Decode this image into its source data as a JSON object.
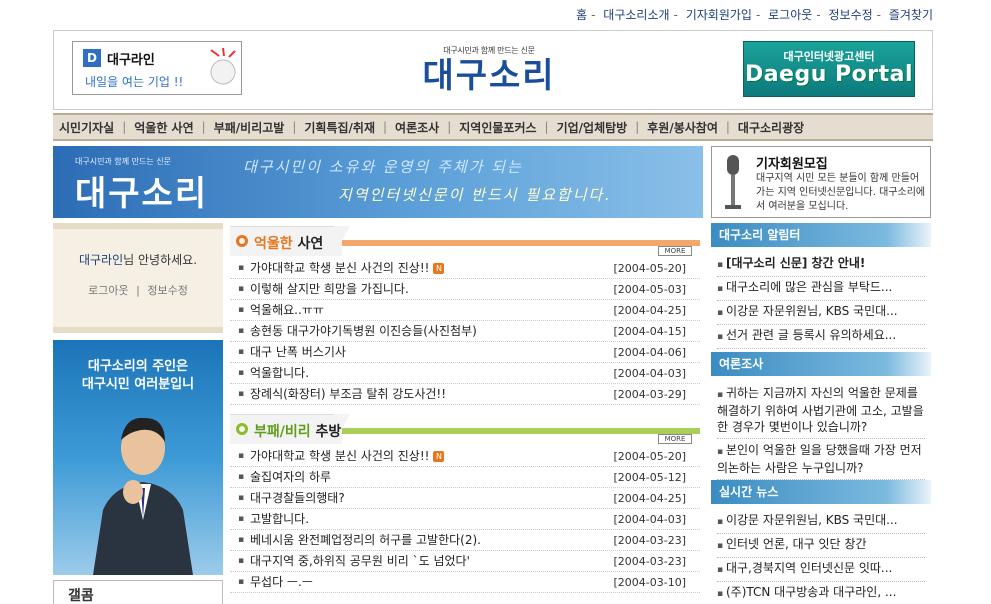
{
  "toplinks": [
    "홈",
    "대구소리소개",
    "기자회원가입",
    "로그아웃",
    "정보수정",
    "즐겨찾기"
  ],
  "header": {
    "daeguline": {
      "icon_letter": "D",
      "title": "대구라인",
      "subtitle": "내일을 여는 기업 !!"
    },
    "logo": {
      "tagline": "대구시민과 함께 만드는 신문",
      "name": "대구소리"
    },
    "portal": {
      "top": "대구인터넷광고센터",
      "main": "Daegu Portal"
    }
  },
  "menu": [
    "시민기자실",
    "억울한 사연",
    "부패/비리고발",
    "기획특집/취재",
    "여론조사",
    "지역인물포커스",
    "기업/업체탐방",
    "후원/봉사참여",
    "대구소리광장"
  ],
  "banner": {
    "tagline": "대구시민과 함께 만드는 신문",
    "logo": "대구소리",
    "line1": "대구시민이 소유와 운영의 주체가 되는",
    "line2": "지역인터넷신문이 반드시 필요합니다."
  },
  "recruit": {
    "title": "기자회원모집",
    "body": "대구지역 시민 모든 분들이 함께 만들어가는 지역 인터넷신문입니다. 대구소리에서 여러분을 모십니다."
  },
  "greeting": {
    "user": "대구라인",
    "suffix": "님 안녕하세요.",
    "logout": "로그아웃",
    "edit": "정보수정",
    "sep": "|"
  },
  "owner_banner": {
    "line1": "대구소리의 주인은",
    "line2": "대구시민 여러분입니"
  },
  "column": {
    "title": "갤콤"
  },
  "sections": [
    {
      "title_hl": "억울한",
      "title_rest": " 사연",
      "more": "MORE",
      "items": [
        {
          "title": "가야대학교 학생 분신 사건의 진상!!",
          "new": true,
          "date": "[2004-05-20]"
        },
        {
          "title": "이렇해 살지만 희망을 가집니다.",
          "new": false,
          "date": "[2004-05-03]"
        },
        {
          "title": "억울해요..ㅠㅠ",
          "new": false,
          "date": "[2004-04-25]"
        },
        {
          "title": "송현동 대구가야기독병원 이진승들(사진첨부)",
          "new": false,
          "date": "[2004-04-15]"
        },
        {
          "title": "대구 난폭 버스기사",
          "new": false,
          "date": "[2004-04-06]"
        },
        {
          "title": "억울합니다.",
          "new": false,
          "date": "[2004-04-03]"
        },
        {
          "title": "장례식(화장터) 부조금 탈취 강도사건!!",
          "new": false,
          "date": "[2004-03-29]"
        }
      ]
    },
    {
      "title_hl": "부패/비리",
      "title_rest": " 추방",
      "more": "MORE",
      "items": [
        {
          "title": "가야대학교 학생 분신 사건의 진상!!",
          "new": true,
          "date": "[2004-05-20]"
        },
        {
          "title": "술집여자의 하루",
          "new": false,
          "date": "[2004-05-12]"
        },
        {
          "title": "대구경찰들의행태?",
          "new": false,
          "date": "[2004-04-25]"
        },
        {
          "title": "고발합니다.",
          "new": false,
          "date": "[2004-04-03]"
        },
        {
          "title": "베네시움 완전폐업정리의 허구를 고발한다(2).",
          "new": false,
          "date": "[2004-03-23]"
        },
        {
          "title": "대구지역 중,하위직 공무원 비리 `도 넘었다'",
          "new": false,
          "date": "[2004-03-23]"
        },
        {
          "title": "무섭다 ㅡ.ㅡ",
          "new": false,
          "date": "[2004-03-10]"
        }
      ]
    }
  ],
  "new_badge": "N",
  "right": {
    "notice": {
      "title": "대구소리 알림터",
      "items": [
        {
          "text": "[대구소리 신문] 창간 안내!",
          "strong": true
        },
        {
          "text": "대구소리에 많은 관심을 부탁드...",
          "strong": false
        },
        {
          "text": "이강문 자문위원님, KBS 국민대...",
          "strong": false
        },
        {
          "text": "선거 관련 글 등록시 유의하세요...",
          "strong": false
        }
      ]
    },
    "poll": {
      "title": "여론조사",
      "items": [
        "귀하는 지금까지 자신의 억울한 문제를 해결하기 위하여 사법기관에 고소, 고발을 한 경우가 몇번이나 있습니까?",
        "본인이 억울한 일을 당했을때 가장 먼저 의논하는 사람은 누구입니까?"
      ]
    },
    "news": {
      "title": "실시간 뉴스",
      "items": [
        "이강문 자문위원님, KBS 국민대...",
        "인터넷 언론, 대구 잇단 창간",
        "대구,경북지역 인터넷신문 잇따...",
        "(주)TCN 대구방송과 대구라인, ..."
      ]
    }
  },
  "colors": {
    "accent_blue": "#1a4e9b",
    "orange": "#e8761c",
    "green": "#5e9d1a",
    "menu_bg": "#e4ddd0"
  }
}
